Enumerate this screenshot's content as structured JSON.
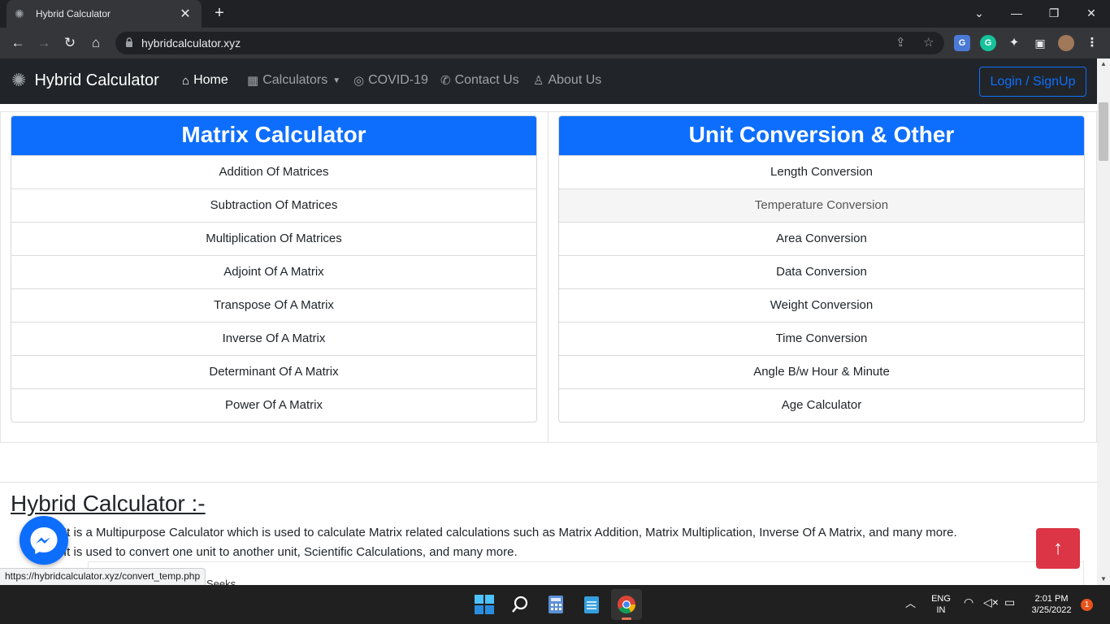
{
  "browser": {
    "tab_title": "Hybrid Calculator",
    "tab_close": "✕",
    "new_tab": "+",
    "url": "hybridcalculator.xyz",
    "status_url": "https://hybridcalculator.xyz/convert_temp.php"
  },
  "navbar": {
    "brand": "Hybrid Calculator",
    "items": [
      {
        "label": "Home",
        "icon": "home-icon"
      },
      {
        "label": "Calculators",
        "icon": "calculator-icon"
      },
      {
        "label": "COVID-19",
        "icon": "target-icon"
      },
      {
        "label": "Contact Us",
        "icon": "phone-icon"
      },
      {
        "label": "About Us",
        "icon": "person-icon"
      }
    ],
    "login": "Login / SignUp"
  },
  "matrix_card": {
    "title": "Matrix Calculator",
    "items": [
      "Addition Of Matrices",
      "Subtraction Of Matrices",
      "Multiplication Of Matrices",
      "Adjoint Of A Matrix",
      "Transpose Of A Matrix",
      "Inverse Of A Matrix",
      "Determinant Of A Matrix",
      "Power Of A Matrix"
    ]
  },
  "unit_card": {
    "title": "Unit Conversion & Other",
    "items": [
      "Length Conversion",
      "Temperature Conversion",
      "Area Conversion",
      "Data Conversion",
      "Weight Conversion",
      "Time Conversion",
      "Angle B/w Hour & Minute",
      "Age Calculator"
    ]
  },
  "about": {
    "heading": "Hybrid Calculator :-",
    "line1": "It is a Multipurpose Calculator which is used to calculate Matrix related calculations such as Matrix Addition, Matrix Multiplication, Inverse Of A Matrix, and many more.",
    "line2": "It is used to convert one unit to another unit, Scientific Calculations, and many more.",
    "ad_fragment": "Seeks"
  },
  "taskbar": {
    "lang_top": "ENG",
    "lang_bottom": "IN",
    "time": "2:01 PM",
    "date": "3/25/2022",
    "notifications": "1"
  },
  "colors": {
    "primary": "#0d6efd",
    "danger": "#dc3545",
    "navbar": "#212529"
  }
}
